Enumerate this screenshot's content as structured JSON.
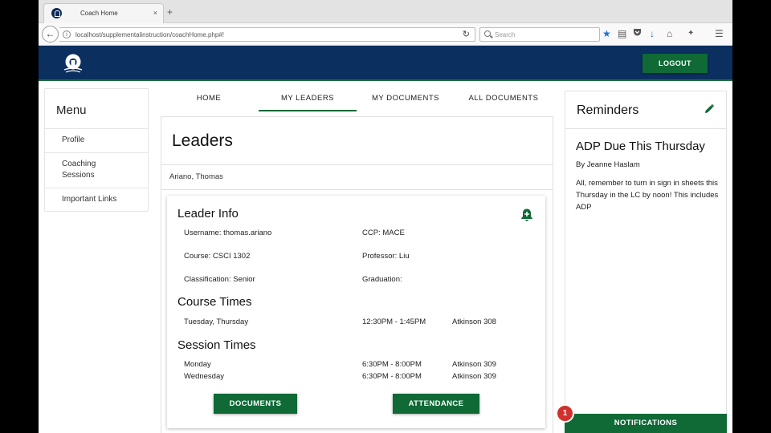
{
  "browser": {
    "tab_title": "Coach Home",
    "tab_close": "×",
    "new_tab": "+",
    "url": "localhost/supplementalinstruction/coachHome.php#!",
    "search_placeholder": "Search",
    "icons": [
      "back-arrow-icon",
      "info-icon",
      "reload-icon",
      "search-icon",
      "bookmark-star-icon",
      "reading-list-icon",
      "pocket-icon",
      "download-icon",
      "home-icon",
      "extension-icon",
      "hamburger-menu-icon"
    ]
  },
  "header": {
    "logout_label": "LOGOUT",
    "colors": {
      "header_bg": "#0b2f5e",
      "accent_green": "#0f6a36"
    }
  },
  "menu": {
    "title": "Menu",
    "items": [
      {
        "label": "Profile"
      },
      {
        "label": "Coaching Sessions"
      },
      {
        "label": "Important Links"
      }
    ]
  },
  "tabs": [
    {
      "label": "HOME"
    },
    {
      "label": "MY LEADERS",
      "active": true
    },
    {
      "label": "MY DOCUMENTS"
    },
    {
      "label": "ALL DOCUMENTS"
    }
  ],
  "leaders": {
    "title": "Leaders",
    "selected_leader": "Ariano, Thomas"
  },
  "leader_info": {
    "heading": "Leader Info",
    "username": "Username: thomas.ariano",
    "ccp": "CCP: MACE",
    "course": "Course: CSCI 1302",
    "professor": "Professor: Liu",
    "classification": "Classification: Senior",
    "graduation": "Graduation:"
  },
  "course_times": {
    "heading": "Course Times",
    "rows": [
      {
        "days": "Tuesday, Thursday",
        "time": "12:30PM - 1:45PM",
        "location": "Atkinson 308"
      }
    ]
  },
  "session_times": {
    "heading": "Session Times",
    "rows": [
      {
        "day": "Monday",
        "time": "6:30PM - 8:00PM",
        "location": "Atkinson 309"
      },
      {
        "day": "Wednesday",
        "time": "6:30PM - 8:00PM",
        "location": "Atkinson 309"
      }
    ]
  },
  "card_buttons": {
    "documents_label": "DOCUMENTS",
    "attendance_label": "ATTENDANCE"
  },
  "reminders": {
    "title": "Reminders",
    "item": {
      "heading": "ADP Due This Thursday",
      "author": "By Jeanne Haslam",
      "body": "All, remember to turn in sign in sheets this Thursday in the LC by noon! This includes ADP"
    }
  },
  "notifications": {
    "label": "NOTIFICATIONS",
    "count": "1"
  }
}
